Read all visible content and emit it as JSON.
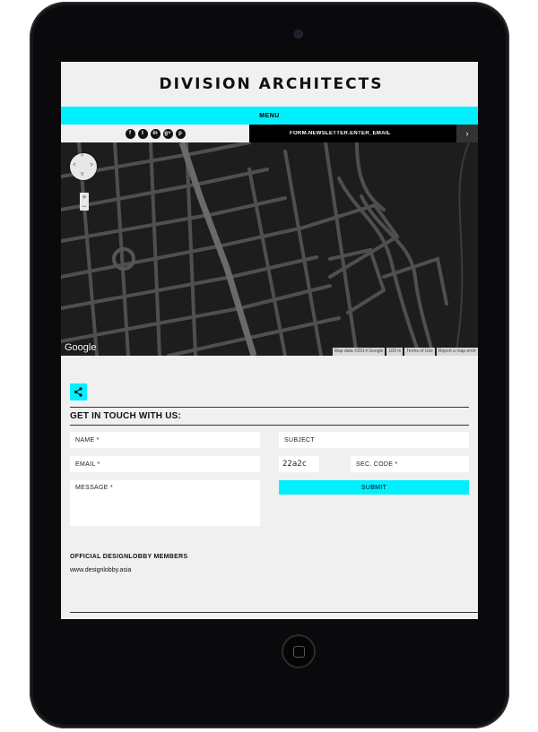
{
  "brand": {
    "logo_text": "DIVISION ARCHITECTS"
  },
  "nav": {
    "menu_label": "MENU"
  },
  "social": {
    "icons": [
      {
        "name": "facebook",
        "glyph": "f"
      },
      {
        "name": "twitter",
        "glyph": "t"
      },
      {
        "name": "linkedin",
        "glyph": "in"
      },
      {
        "name": "google-plus",
        "glyph": "g+"
      },
      {
        "name": "pinterest",
        "glyph": "p"
      }
    ]
  },
  "newsletter": {
    "placeholder": "FORM.NEWSLETTER.ENTER_EMAIL",
    "submit_glyph": "›"
  },
  "map": {
    "provider_label": "Google",
    "attribution": [
      "Map data ©2014 Google",
      "100 m",
      "Terms of Use",
      "Report a map error"
    ],
    "zoom_in": "+",
    "zoom_out": "−",
    "colors": {
      "background": "#1d1d1d",
      "roads": "#5a5a5a"
    }
  },
  "contact": {
    "title": "GET IN TOUCH WITH US:",
    "fields": {
      "name": "NAME *",
      "email": "EMAIL *",
      "message": "MESSAGE *",
      "subject": "SUBJECT",
      "captcha_text": "22a2c",
      "security_code": "SEC. CODE *"
    },
    "submit_label": "SUBMIT"
  },
  "members": {
    "title": "OFFICIAL DESIGNLOBBY MEMBERS",
    "link": "www.designlobby.asia"
  },
  "colors": {
    "accent": "#00f0ff",
    "page_bg": "#f0f0f0",
    "device": "#0a0a0d"
  }
}
